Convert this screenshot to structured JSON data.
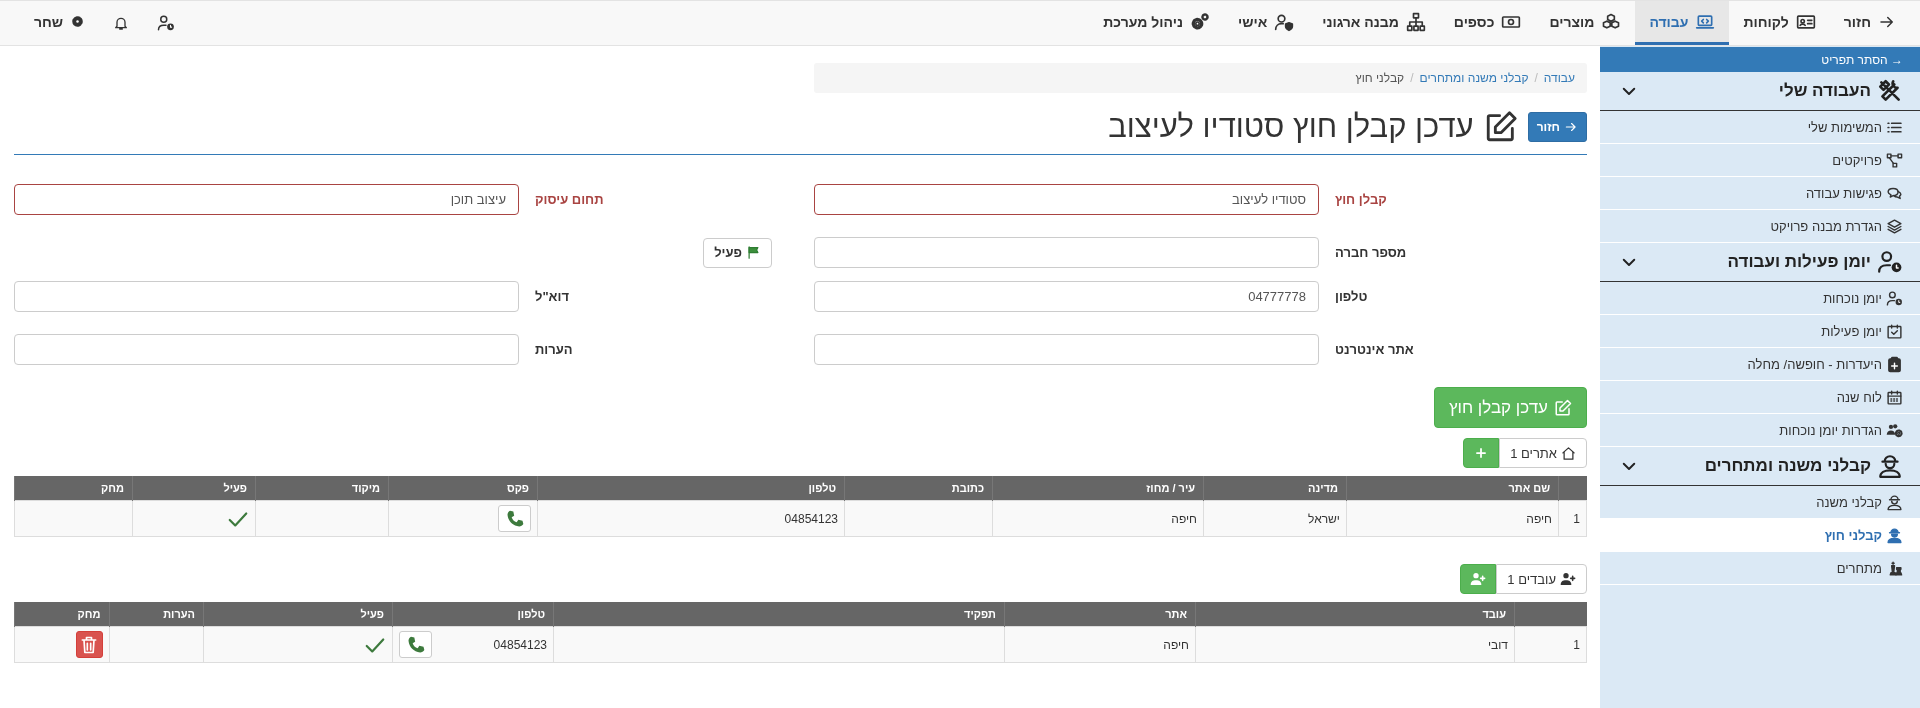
{
  "top_nav": {
    "back": "חזור",
    "items": [
      {
        "label": "לקוחות",
        "selected": false
      },
      {
        "label": "עבודה",
        "selected": true
      },
      {
        "label": "מוצרים",
        "selected": false
      },
      {
        "label": "כספים",
        "selected": false
      },
      {
        "label": "מבנה ארגוני",
        "selected": false
      },
      {
        "label": "אישי",
        "selected": false
      },
      {
        "label": "ניהול מערכת",
        "selected": false
      }
    ],
    "user": "שחר"
  },
  "sidebar": {
    "toggle": "→ הסתר תפריט",
    "sections": [
      {
        "title": "העבודה שלי",
        "expanded": true,
        "items": [
          {
            "label": "המשימות שלי",
            "selected": false
          },
          {
            "label": "פרויקטים",
            "selected": false
          },
          {
            "label": "פגישות עבודה",
            "selected": false
          },
          {
            "label": "הגדרת מבנה פרויקט",
            "selected": false
          }
        ]
      },
      {
        "title": "יומן פעילות ועבודה",
        "expanded": true,
        "items": [
          {
            "label": "יומן נוכחות",
            "selected": false
          },
          {
            "label": "יומן פעילות",
            "selected": false
          },
          {
            "label": "היעדרות - חופשה/ מחלה",
            "selected": false
          },
          {
            "label": "לוח שנה",
            "selected": false
          },
          {
            "label": "הגדרות יומן נוכחות",
            "selected": false
          }
        ]
      },
      {
        "title": "קבלני משנה ומתחרים",
        "expanded": true,
        "items": [
          {
            "label": "קבלני משנה",
            "selected": false
          },
          {
            "label": "קבלני חוץ",
            "selected": true
          },
          {
            "label": "מתחרים",
            "selected": false
          }
        ]
      }
    ]
  },
  "breadcrumb": {
    "separator": "/",
    "items": [
      "עבודה",
      "קבלני משנה ומתחרים",
      "קבלני חוץ"
    ]
  },
  "page": {
    "back": "חזור",
    "title": "עדכן קבלן חוץ סטודיו לעיצוב"
  },
  "form": {
    "rows": [
      [
        {
          "kind": "field",
          "label": "קבלן חוץ",
          "value": "סטודיו לעיצוב",
          "required": true
        },
        {
          "kind": "field",
          "label": "תחום עיסוק",
          "value": "עיצוב תוכן",
          "required": true
        }
      ],
      [
        {
          "kind": "field",
          "label": "מספר חברה",
          "required": false
        },
        {
          "kind": "toggle",
          "label": "פעיל",
          "on": true
        }
      ],
      [
        {
          "kind": "field",
          "label": "טלפון",
          "value": "04777778",
          "required": false
        },
        {
          "kind": "field",
          "label": "דוא\"ל",
          "required": false
        }
      ],
      [
        {
          "kind": "field",
          "label": "אתר אינטרנט",
          "required": false
        },
        {
          "kind": "field",
          "label": "הערות",
          "required": false
        }
      ]
    ],
    "submit": "עדכן קבלן חוץ"
  },
  "sites": {
    "button": "אתרים 1",
    "table": {
      "columns": [
        "",
        "שם אתר",
        "מדינה",
        "עיר / מחוז",
        "כתובת",
        "טלפון",
        "פקס",
        "מיקוד",
        "פעיל",
        "מחק"
      ],
      "rows": [
        [
          {
            "kind": "text",
            "value": "1"
          },
          {
            "kind": "text",
            "value": "חיפה"
          },
          {
            "kind": "text",
            "value": "ישראל"
          },
          {
            "kind": "text",
            "value": "חיפה"
          },
          {
            "kind": "empty"
          },
          {
            "kind": "text",
            "value": "04854123"
          },
          {
            "kind": "call"
          },
          {
            "kind": "empty"
          },
          {
            "kind": "check",
            "checked": true
          },
          {
            "kind": "empty"
          }
        ]
      ]
    }
  },
  "workers": {
    "button": "עובדים 1",
    "table": {
      "columns": [
        "",
        "עובד",
        "אתר",
        "תפקיד",
        "טלפון",
        "פעיל",
        "הערות",
        "מחק"
      ],
      "rows": [
        [
          {
            "kind": "text",
            "value": "1"
          },
          {
            "kind": "text",
            "value": "דובי"
          },
          {
            "kind": "text",
            "value": "חיפה"
          },
          {
            "kind": "empty"
          },
          {
            "kind": "phone",
            "value": "04854123"
          },
          {
            "kind": "check",
            "checked": true
          },
          {
            "kind": "empty"
          },
          {
            "kind": "delete"
          }
        ]
      ]
    }
  }
}
